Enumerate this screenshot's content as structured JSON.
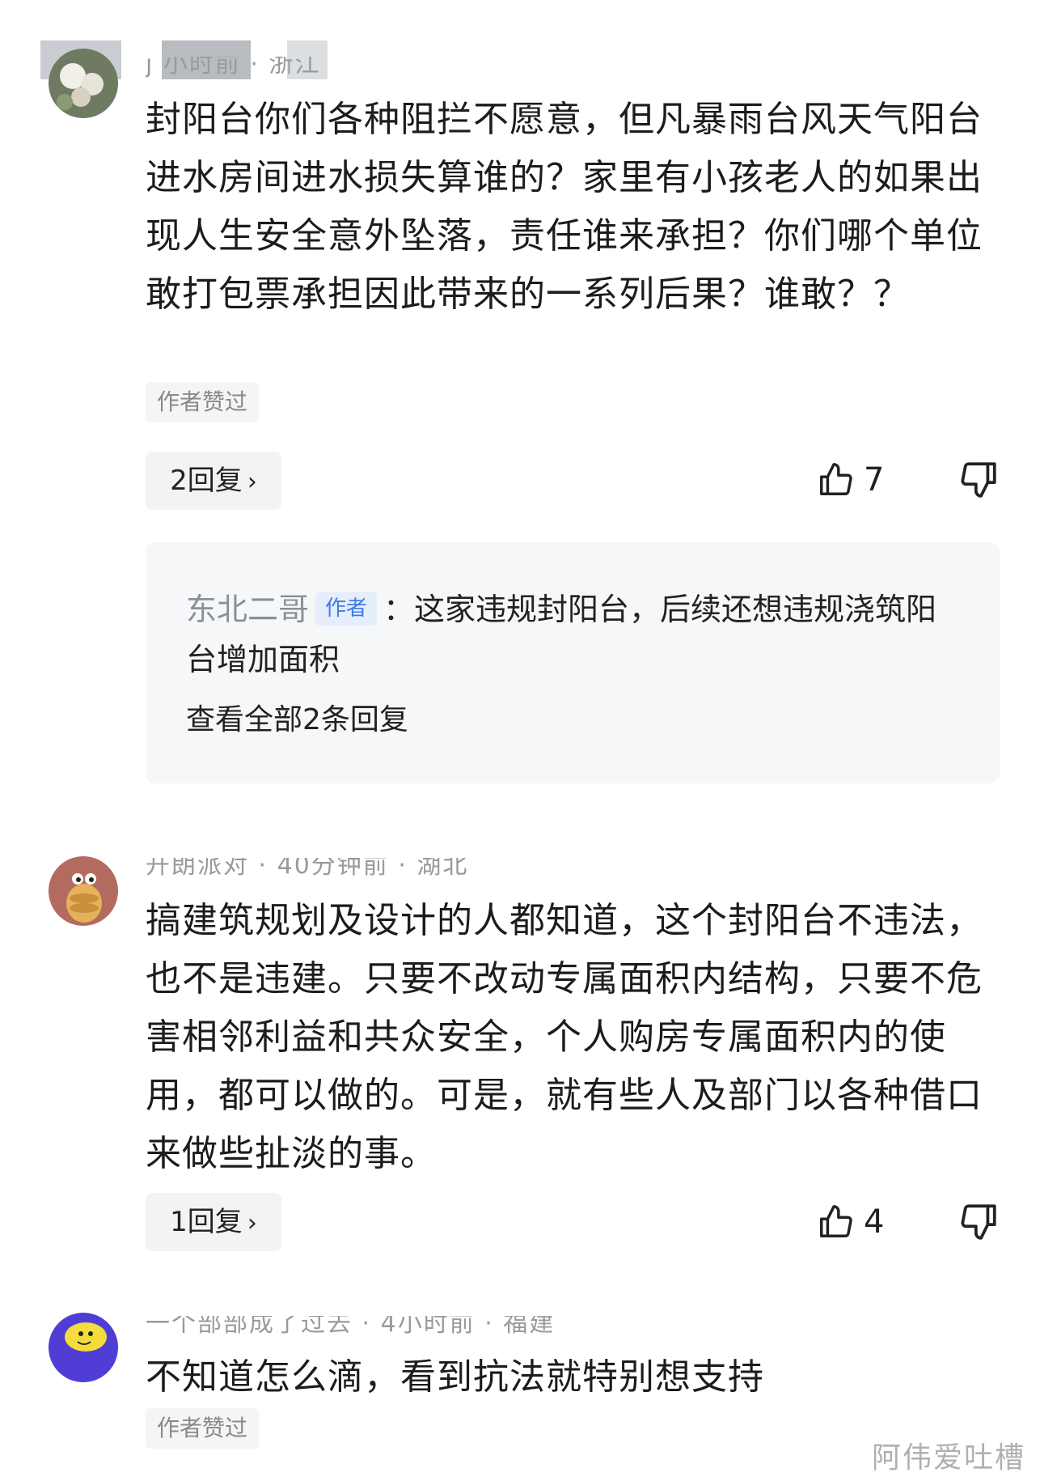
{
  "comments": [
    {
      "meta": "j 小时前 · 浙江",
      "text": "封阳台你们各种阻拦不愿意，但凡暴雨台风天气阳台进水房间进水损失算谁的？家里有小孩老人的如果出现人生安全意外坠落，责任谁来承担？你们哪个单位敢打包票承担因此带来的一系列后果？谁敢？？",
      "badge": "作者赞过",
      "reply_label": "2回复",
      "likes": "7"
    },
    {
      "meta": "开朗派对 · 40分钟前 · 湖北",
      "text": "搞建筑规划及设计的人都知道，这个封阳台不违法，也不是违建。只要不改动专属面积内结构，只要不危害相邻利益和共众安全，个人购房专属面积内的使用，都可以做的。可是，就有些人及部门以各种借口来做些扯淡的事。",
      "reply_label": "1回复",
      "likes": "4"
    },
    {
      "meta": "一个部部成了过去 · 4小时前 · 福建",
      "text": "不知道怎么滴，看到抗法就特别想支持",
      "badge": "作者赞过"
    }
  ],
  "reply_preview": {
    "author": "东北二哥",
    "tag": "作者",
    "text": "：这家违规封阳台，后续还想违规浇筑阳台增加面积",
    "view_all": "查看全部2条回复"
  },
  "watermark": "阿伟爱吐槽",
  "icons": {
    "like": "thumbs-up-icon",
    "dislike": "thumbs-down-icon",
    "chevron": "chevron-right-icon"
  },
  "colors": {
    "author_tag_bg": "#e6eefc",
    "author_tag_text": "#3d7be6",
    "pill_bg": "#f2f3f5"
  }
}
